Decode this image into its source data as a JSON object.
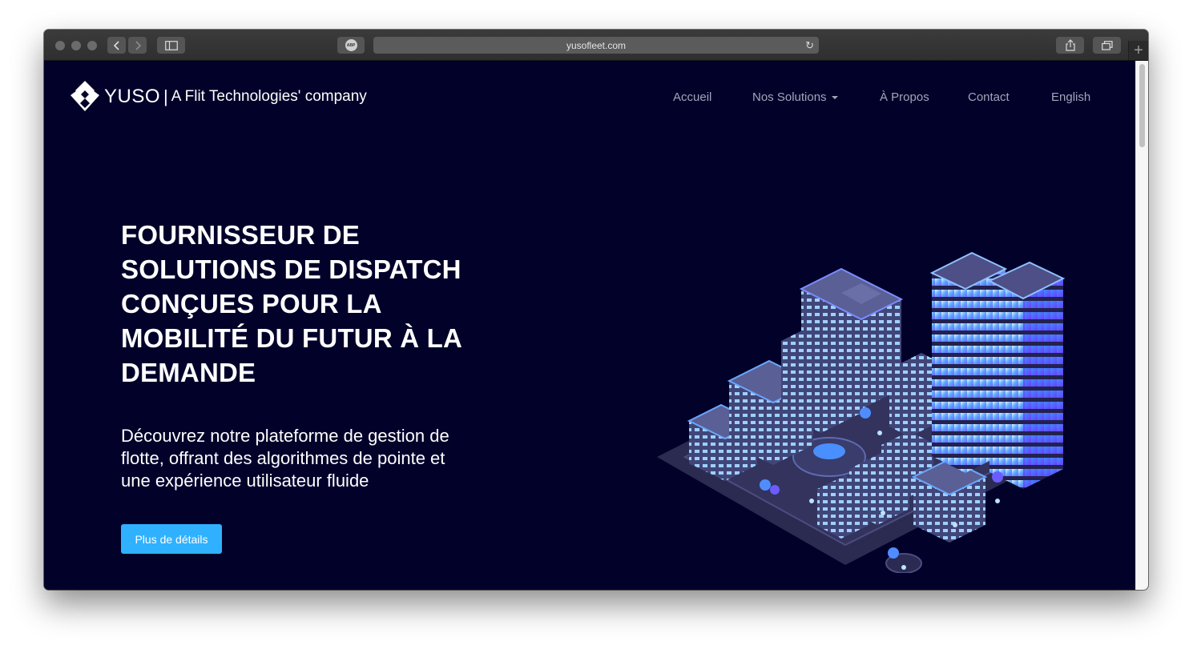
{
  "browser": {
    "url": "yusofleet.com",
    "abp_label": "ABP"
  },
  "site": {
    "brand": "YUSO",
    "tagline": "A Flit Technologies' company"
  },
  "nav": {
    "items": [
      {
        "label": "Accueil"
      },
      {
        "label": "Nos Solutions"
      },
      {
        "label": "À Propos"
      },
      {
        "label": "Contact"
      },
      {
        "label": "English"
      }
    ]
  },
  "hero": {
    "title_lines": [
      "FOURNISSEUR DE",
      "SOLUTIONS DE DISPATCH",
      "CONÇUES POUR LA",
      "MOBILITÉ DU FUTUR À LA",
      "DEMANDE"
    ],
    "subtitle_lines": [
      "Découvrez notre plateforme de gestion de",
      "flotte, offrant des algorithmes de pointe et",
      "une expérience utilisateur fluide"
    ],
    "cta_label": "Plus de détails"
  },
  "colors": {
    "background": "#02012a",
    "accent": "#2fb1ff",
    "nav_text": "#a1a6ba",
    "building_blue": "#3fa0ff",
    "building_purple": "#7b5cff"
  }
}
